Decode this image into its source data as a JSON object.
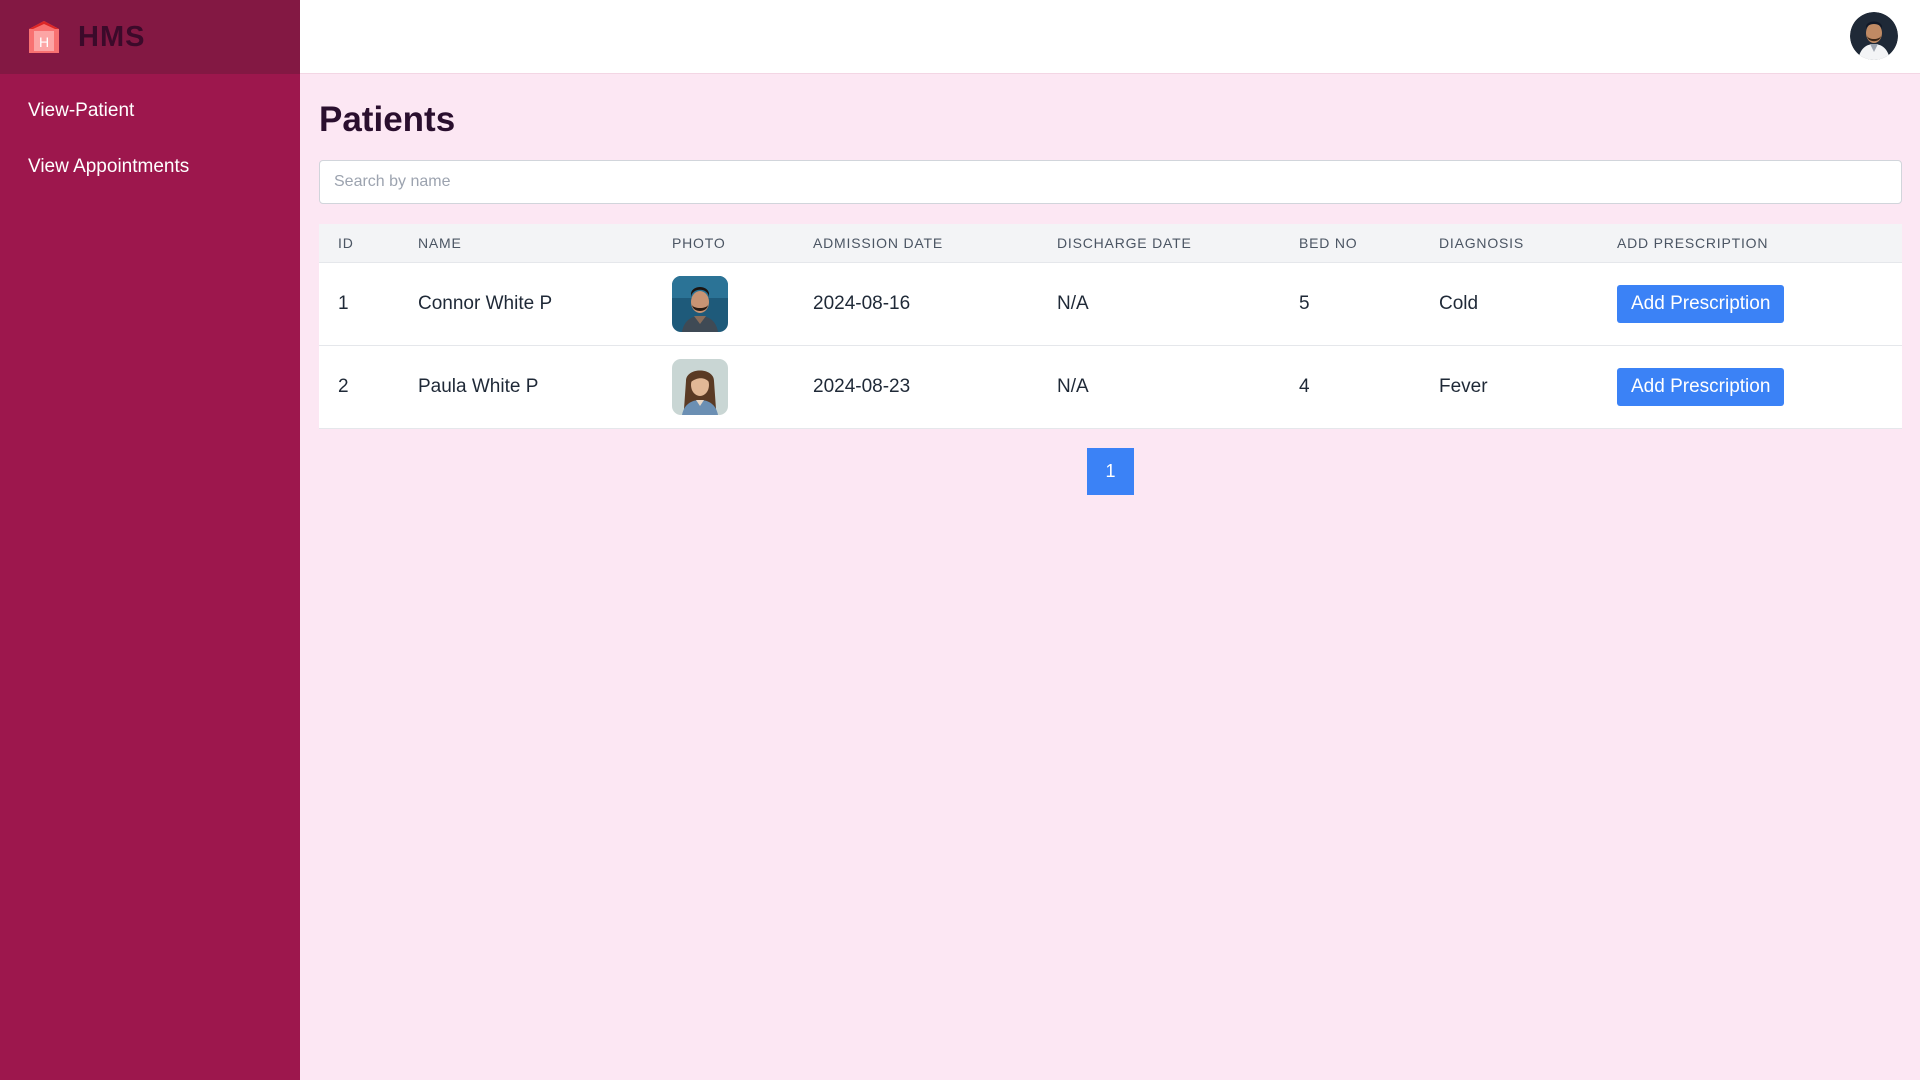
{
  "brand": {
    "name": "HMS",
    "logo_icon": "hospital-icon",
    "logo_letter": "H"
  },
  "sidebar": {
    "items": [
      {
        "label": "View-Patient"
      },
      {
        "label": "View Appointments"
      }
    ]
  },
  "header": {
    "avatar_icon": "user-avatar"
  },
  "main": {
    "title": "Patients",
    "search": {
      "placeholder": "Search by name",
      "value": ""
    },
    "table": {
      "columns": [
        "ID",
        "NAME",
        "PHOTO",
        "ADMISSION DATE",
        "DISCHARGE DATE",
        "BED NO",
        "DIAGNOSIS",
        "ADD PRESCRIPTION"
      ],
      "rows": [
        {
          "id": "1",
          "name": "Connor White P",
          "photo": "male-patient-photo",
          "admission": "2024-08-16",
          "discharge": "N/A",
          "bed": "5",
          "diagnosis": "Cold",
          "action": "Add Prescription"
        },
        {
          "id": "2",
          "name": "Paula White P",
          "photo": "female-patient-photo",
          "admission": "2024-08-23",
          "discharge": "N/A",
          "bed": "4",
          "diagnosis": "Fever",
          "action": "Add Prescription"
        }
      ]
    },
    "pagination": {
      "pages": [
        "1"
      ],
      "current": "1"
    }
  },
  "colors": {
    "sidebar": "#9d174d",
    "brand_bar": "#831843",
    "page_bg": "#fce7f3",
    "accent": "#3b82f6"
  }
}
